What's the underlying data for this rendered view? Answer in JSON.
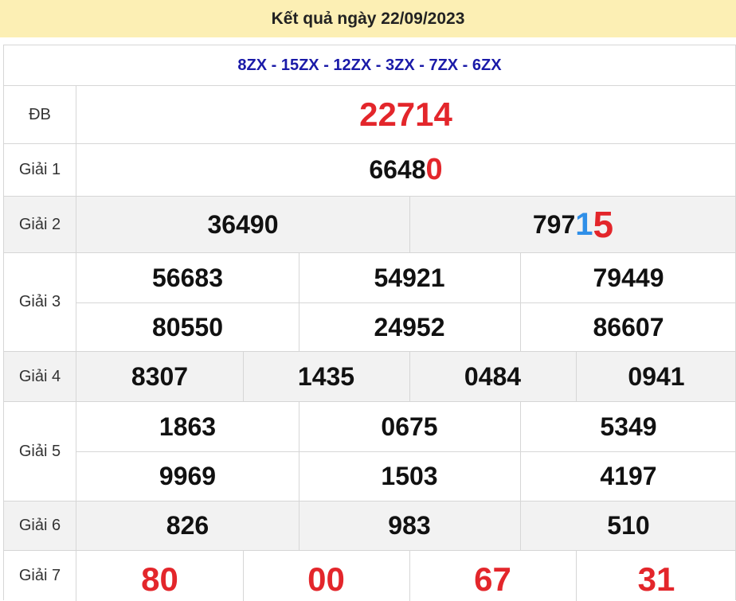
{
  "header": {
    "title": "Kết quả ngày 22/09/2023"
  },
  "codes": "8ZX - 15ZX - 12ZX - 3ZX - 7ZX - 6ZX",
  "prizes": {
    "db": {
      "label": "ĐB",
      "value": "22714"
    },
    "g1": {
      "label": "Giải 1",
      "prefix": "6648",
      "last": "0"
    },
    "g2": {
      "label": "Giải 2",
      "n1": "36490",
      "n2_prefix": "797",
      "n2_blue": "1",
      "n2_red": "5"
    },
    "g3": {
      "label": "Giải 3",
      "values": [
        "56683",
        "54921",
        "79449",
        "80550",
        "24952",
        "86607"
      ]
    },
    "g4": {
      "label": "Giải 4",
      "values": [
        "8307",
        "1435",
        "0484",
        "0941"
      ]
    },
    "g5": {
      "label": "Giải 5",
      "values": [
        "1863",
        "0675",
        "5349",
        "9969",
        "1503",
        "4197"
      ]
    },
    "g6": {
      "label": "Giải 6",
      "values": [
        "826",
        "983",
        "510"
      ]
    },
    "g7": {
      "label": "Giải 7",
      "values": [
        "80",
        "00",
        "67",
        "31"
      ]
    }
  },
  "colors": {
    "header_bg": "#fcefb4",
    "red": "#e3262b",
    "blue": "#2f8fe8",
    "code_blue": "#1a1aa8",
    "row_gray": "#f2f2f2"
  }
}
